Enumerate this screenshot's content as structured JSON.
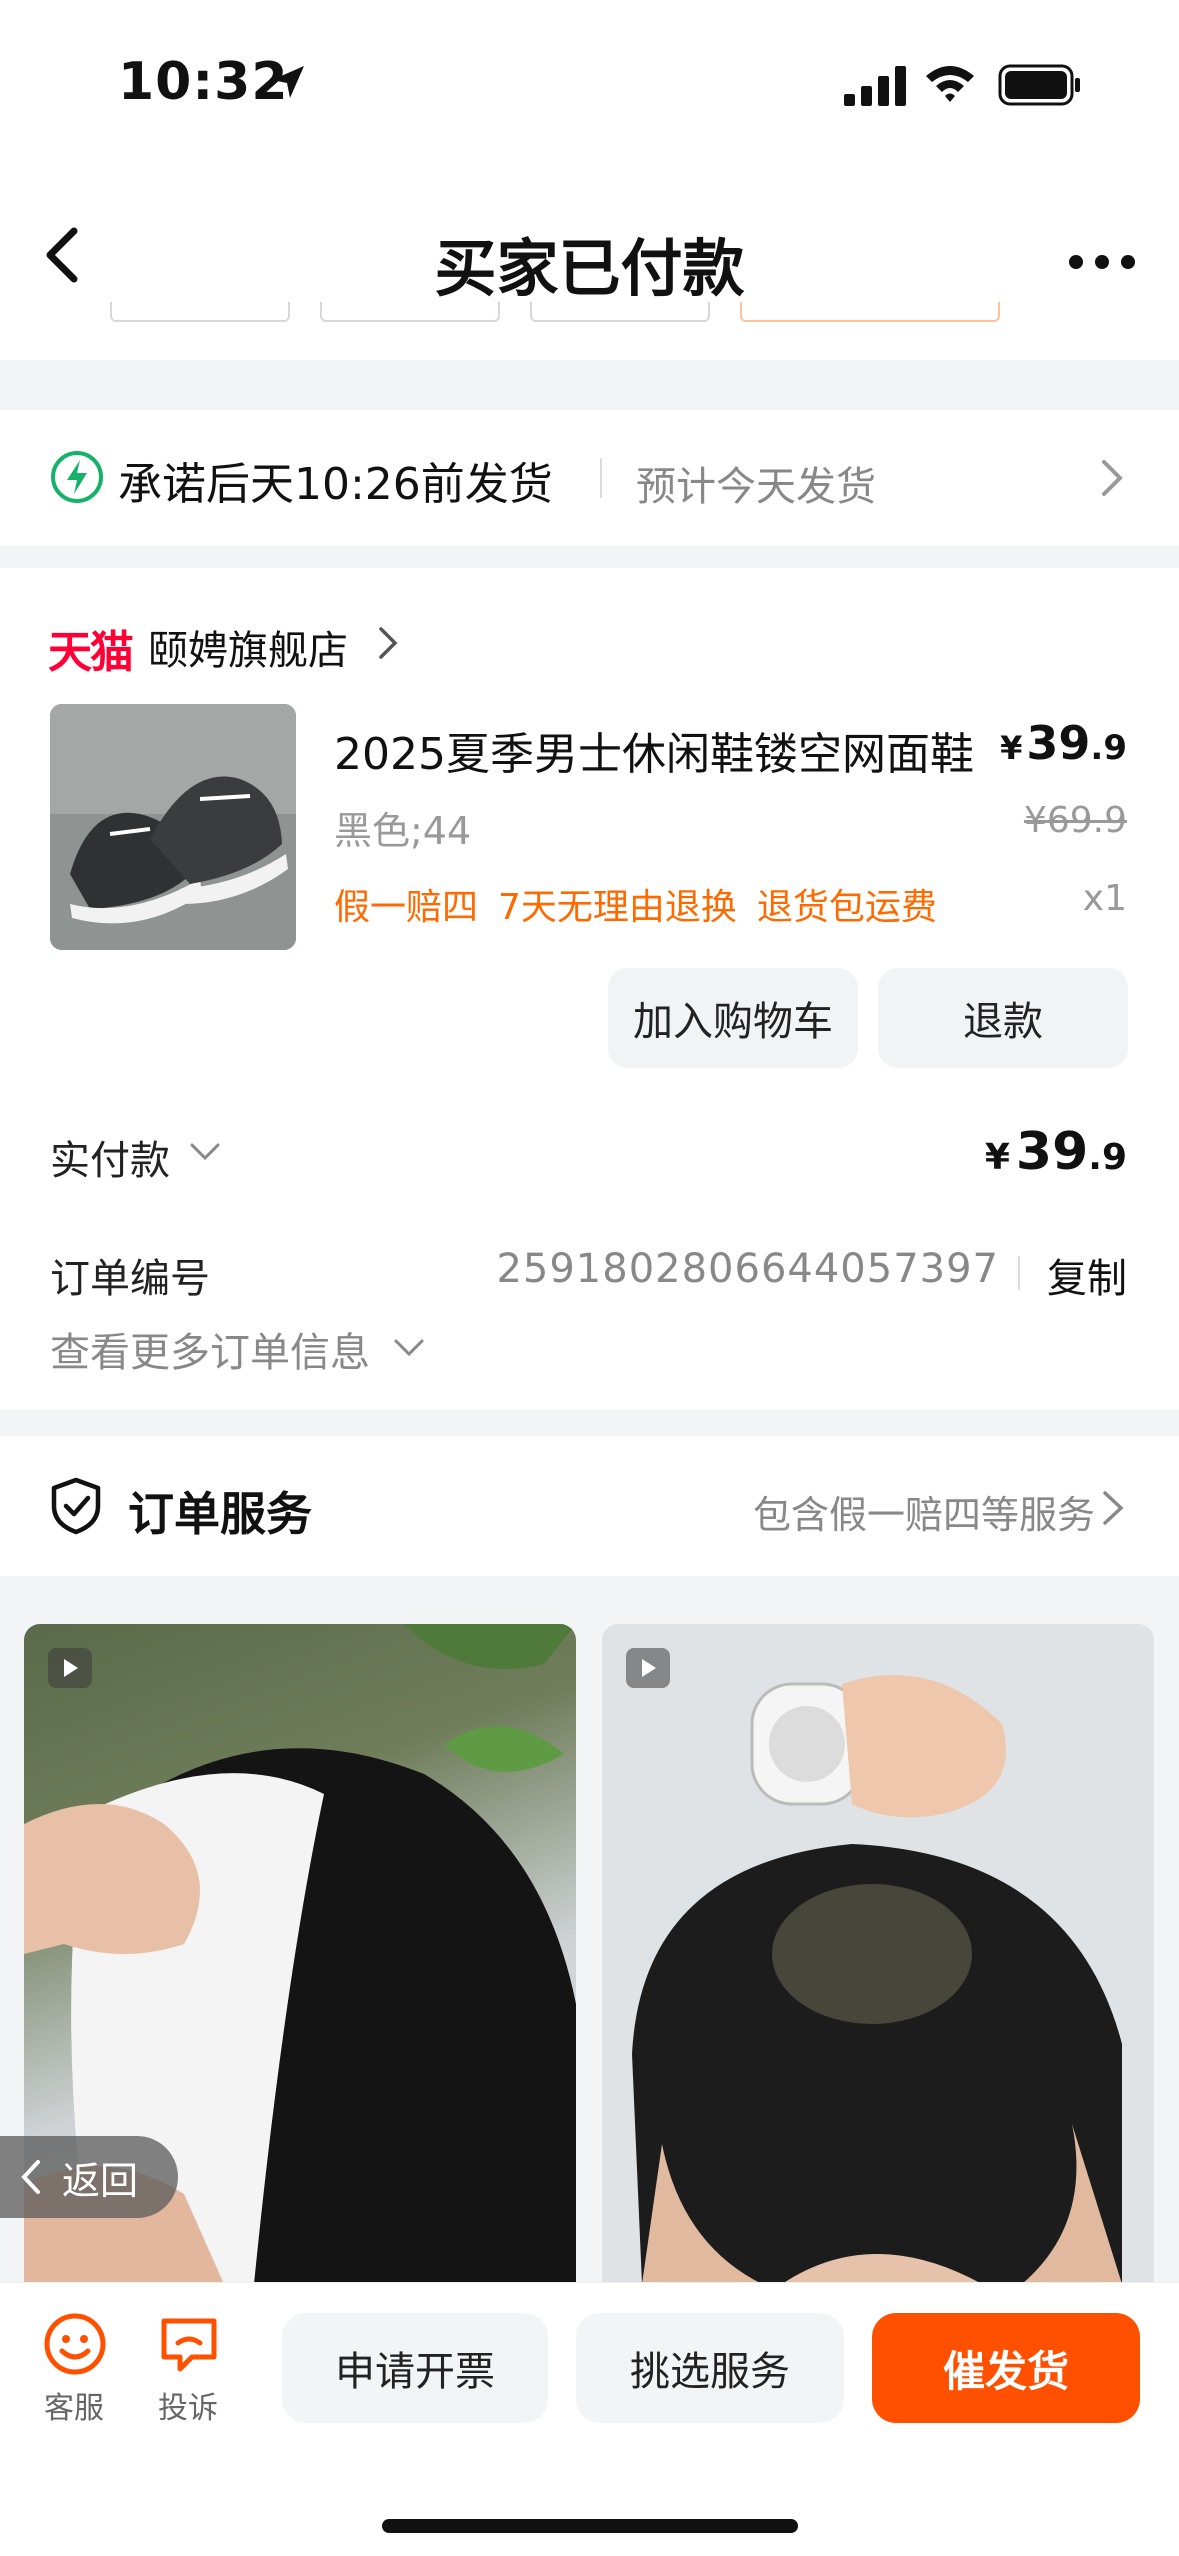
{
  "status_bar": {
    "time": "10:32"
  },
  "header": {
    "title": "买家已付款"
  },
  "delivery": {
    "promise": "承诺后天10:26前发货",
    "estimate": "预计今天发货"
  },
  "shop": {
    "brand": "天猫",
    "name": "颐娉旗舰店"
  },
  "product": {
    "title": "2025夏季男士休闲鞋镂空网面鞋",
    "price_currency": "¥",
    "price_int": "39",
    "price_dec": ".9",
    "variant": "黑色;44",
    "original_price": "¥69.9",
    "guarantees": [
      "假一赔四",
      "7天无理由退换",
      "退货包运费"
    ],
    "quantity": "x1",
    "actions": {
      "cart": "加入购物车",
      "refund": "退款"
    }
  },
  "payment": {
    "label": "实付款",
    "currency": "¥",
    "amount_int": "39",
    "amount_dec": ".9"
  },
  "order": {
    "number_label": "订单编号",
    "number": "2591802806644057397",
    "copy": "复制",
    "more_info": "查看更多订单信息"
  },
  "service": {
    "title": "订单服务",
    "summary": "包含假一赔四等服务"
  },
  "float_back": {
    "label": "返回"
  },
  "bottom_bar": {
    "customer_service": "客服",
    "complaint": "投诉",
    "invoice": "申请开票",
    "choose_service": "挑选服务",
    "urge_shipping": "催发货"
  },
  "colors": {
    "accent": "#ff5000",
    "guarantee": "#ff6a00",
    "tmall": "#ff0036",
    "promise_icon": "#17b26a"
  }
}
